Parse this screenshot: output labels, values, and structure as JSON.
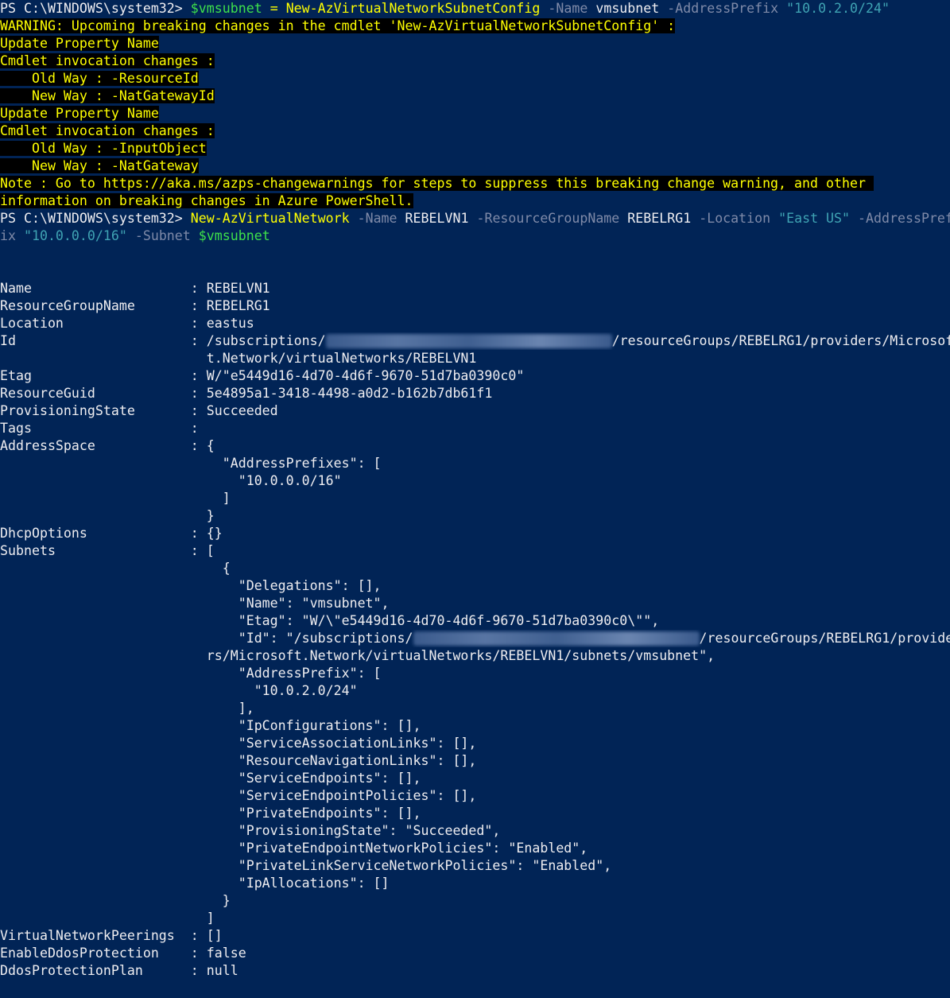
{
  "colors": {
    "background": "#012456",
    "text": "#eeedf0",
    "warning_fg": "#ffff00",
    "warning_bg": "#000000",
    "command": "#ffff00",
    "variable": "#3ee04b",
    "parameter": "#7f8aa8",
    "string": "#3fa3b3"
  },
  "cmd1": {
    "prompt": "PS C:\\WINDOWS\\system32> ",
    "var": "$vmsubnet",
    "eq": " = ",
    "cmdlet": "New-AzVirtualNetworkSubnetConfig",
    "p1": " -Name",
    "v1": " vmsubnet",
    "p2": " -AddressPrefix",
    "v2": " \"10.0.2.0/24\""
  },
  "warning": [
    "WARNING: Upcoming breaking changes in the cmdlet 'New-AzVirtualNetworkSubnetConfig' :",
    "Update Property Name",
    "Cmdlet invocation changes :",
    "    Old Way : -ResourceId",
    "    New Way : -NatGatewayId",
    "Update Property Name",
    "Cmdlet invocation changes :",
    "    Old Way : -InputObject",
    "    New Way : -NatGateway",
    "Note : Go to https://aka.ms/azps-changewarnings for steps to suppress this breaking change warning, and other ",
    "information on breaking changes in Azure PowerShell."
  ],
  "cmd2": {
    "prompt": "PS C:\\WINDOWS\\system32> ",
    "cmdlet": "New-AzVirtualNetwork",
    "p1": " -Name",
    "v1": " REBELVN1",
    "p2": " -ResourceGroupName",
    "v2": " REBELRG1",
    "p3": " -Location",
    "v3": " \"East US\"",
    "p4a": " -AddressPref",
    "p4b": "ix",
    "v4": " \"10.0.0.0/16\"",
    "p5": " -Subnet",
    "v5": " $vmsubnet"
  },
  "output": {
    "name": "Name                    : REBELVN1",
    "rg": "ResourceGroupName       : REBELRG1",
    "location": "Location                : eastus",
    "id_start": "Id                      : /subscriptions/",
    "id_end": "/resourceGroups/REBELRG1/providers/Microsof",
    "id_cont": "                          t.Network/virtualNetworks/REBELVN1",
    "etag": "Etag                    : W/\"e5449d16-4d70-4d6f-9670-51d7ba0390c0\"",
    "guid": "ResourceGuid            : 5e4895a1-3418-4498-a0d2-b162b7db61f1",
    "state": "ProvisioningState       : Succeeded",
    "tags": "Tags                    :",
    "addr1": "AddressSpace            : {",
    "addr2": "                            \"AddressPrefixes\": [",
    "addr3": "                              \"10.0.0.0/16\"",
    "addr4": "                            ]",
    "addr5": "                          }",
    "dhcp": "DhcpOptions             : {}",
    "subnets": "Subnets                 : [",
    "s1": "                            {",
    "s2": "                              \"Delegations\": [],",
    "s3": "                              \"Name\": \"vmsubnet\",",
    "s4": "                              \"Etag\": \"W/\\\"e5449d16-4d70-4d6f-9670-51d7ba0390c0\\\"\",",
    "s5_start": "                              \"Id\": \"/subscriptions/",
    "s5_end": "/resourceGroups/REBELRG1/provide",
    "s6": "                          rs/Microsoft.Network/virtualNetworks/REBELVN1/subnets/vmsubnet\",",
    "s7": "                              \"AddressPrefix\": [",
    "s8": "                                \"10.0.2.0/24\"",
    "s9": "                              ],",
    "s10": "                              \"IpConfigurations\": [],",
    "s11": "                              \"ServiceAssociationLinks\": [],",
    "s12": "                              \"ResourceNavigationLinks\": [],",
    "s13": "                              \"ServiceEndpoints\": [],",
    "s14": "                              \"ServiceEndpointPolicies\": [],",
    "s15": "                              \"PrivateEndpoints\": [],",
    "s16": "                              \"ProvisioningState\": \"Succeeded\",",
    "s17": "                              \"PrivateEndpointNetworkPolicies\": \"Enabled\",",
    "s18": "                              \"PrivateLinkServiceNetworkPolicies\": \"Enabled\",",
    "s19": "                              \"IpAllocations\": []",
    "s20": "                            }",
    "s21": "                          ]",
    "peer": "VirtualNetworkPeerings  : []",
    "ddos": "EnableDdosProtection    : false",
    "ddosplan": "DdosProtectionPlan      : null"
  }
}
